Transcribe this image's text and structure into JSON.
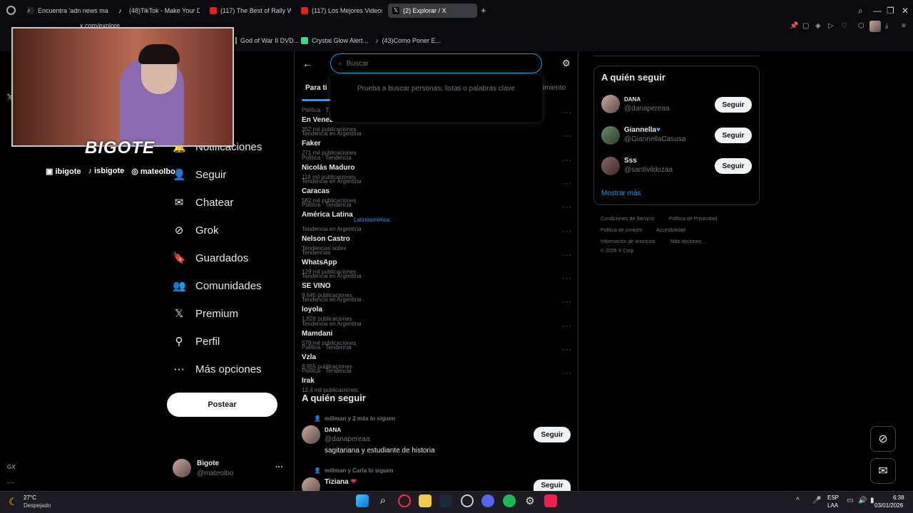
{
  "browser": {
    "tabs": [
      {
        "label": "Encuentra 'adn news mad",
        "icon": "tiktok-icon"
      },
      {
        "label": "(48)TikTok - Make Your D",
        "icon": "tiktok-icon"
      },
      {
        "label": "(117) The Best of Rally WR",
        "icon": "youtube-icon"
      },
      {
        "label": "(117) Los Mejores Videos",
        "icon": "youtube-icon"
      },
      {
        "label": "(2) Explorar / X",
        "icon": "x-icon"
      }
    ],
    "new_tab": "+",
    "url": "x.com/explore",
    "bookmarks": [
      "God of War II DVD...",
      "Crystal Glow Alert...",
      "(43)Como Poner E..."
    ]
  },
  "webcam": {
    "brand": "BIGOTE",
    "socials": [
      "ibigote",
      "isbigote",
      "mateolbo"
    ]
  },
  "sidebar": {
    "items": [
      {
        "label": "Notificaciones",
        "icon": "bell-icon"
      },
      {
        "label": "Seguir",
        "icon": "follow-icon"
      },
      {
        "label": "Chatear",
        "icon": "mail-icon"
      },
      {
        "label": "Grok",
        "icon": "grok-icon"
      },
      {
        "label": "Guardados",
        "icon": "bookmark-icon"
      },
      {
        "label": "Comunidades",
        "icon": "communities-icon"
      },
      {
        "label": "Premium",
        "icon": "x-icon"
      },
      {
        "label": "Perfil",
        "icon": "person-icon"
      },
      {
        "label": "Más opciones",
        "icon": "more-icon"
      }
    ],
    "post_button": "Postear",
    "account": {
      "name": "Bigote",
      "handle": "@mateolbo",
      "more": "···"
    }
  },
  "explore": {
    "search_placeholder": "Buscar",
    "search_hint": "Prueba a buscar personas, listas o palabras clave",
    "tab_left": "Para ti",
    "tab_right": "imiento",
    "trends": [
      {
        "context": "Política · T",
        "name": "En Venezuela",
        "count": "352 mil publicaciones"
      },
      {
        "context": "Tendencia en Argentina",
        "name": "Faker",
        "count": "271 mil publicaciones"
      },
      {
        "context": "Política · Tendencia",
        "name": "Nicolás Maduro",
        "count": "118 mil publicaciones"
      },
      {
        "context": "Tendencia en Argentina",
        "name": "Caracas",
        "count": "582 mil publicaciones"
      },
      {
        "context": "Política · Tendencia",
        "name": "América Latina",
        "count": ""
      },
      {
        "context": "Tendencia en Argentina",
        "name": "Nelson Castro",
        "count": "Tendencias sobre",
        "link": "Latinoamérica"
      },
      {
        "context": "Tendencias",
        "name": "WhatsApp",
        "count": "129 mil publicaciones"
      },
      {
        "context": "Tendencia en Argentina",
        "name": "SE VINO",
        "count": "9.645 publicaciones"
      },
      {
        "context": "Tendencia en Argentina",
        "name": "loyola",
        "count": "1.828 publicaciones"
      },
      {
        "context": "Tendencia en Argentina",
        "name": "Mamdani",
        "count": "579 mil publicaciones"
      },
      {
        "context": "Política · Tendencia",
        "name": "Vzla",
        "count": "8.955 publicaciones"
      },
      {
        "context": "Política · Tendencia",
        "name": "Irak",
        "count": "12,4 mil publicaciones"
      }
    ],
    "who_to_follow_title": "A quién seguir",
    "suggestions": [
      {
        "social": "miliman y 2 más lo siguen",
        "name": "DANA",
        "handle": "@danapereaa",
        "bio": "sagitariana y estudiante de historia",
        "button": "Seguir"
      },
      {
        "social": "miliman y Carla lo siguen",
        "name": "Tiziana",
        "handle": "@Tiz...",
        "bio": "",
        "button": "Seguir"
      }
    ]
  },
  "right": {
    "title": "A quién seguir",
    "users": [
      {
        "name": "DANA",
        "handle": "@danapereaa",
        "button": "Seguir"
      },
      {
        "name": "Giannella",
        "handle": "@GiannellaCasusa",
        "button": "Seguir"
      },
      {
        "name": "Sss",
        "handle": "@santivildozaa",
        "button": "Seguir"
      }
    ],
    "show_more": "Mostrar más",
    "footer": [
      "Condiciones de Servicio",
      "Política de Privacidad",
      "Política de cookies",
      "Accesibilidad",
      "Información de anuncios",
      "Más opciones ...",
      "© 2026 X Corp."
    ]
  },
  "taskbar": {
    "weather_temp": "27°C",
    "weather_desc": "Despejado",
    "lang": "ESP",
    "lang2": "LAA",
    "time": "6:38",
    "date": "03/01/2026"
  },
  "gx_label": "GX",
  "colors": {
    "accent": "#1d9bf0",
    "bg": "#000000",
    "muted": "#71767b",
    "border": "#2f3336"
  }
}
